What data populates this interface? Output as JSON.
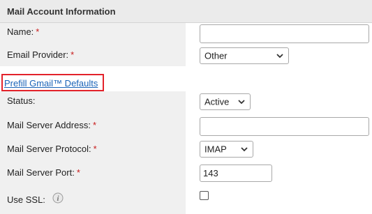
{
  "section": {
    "title": "Mail Account Information",
    "prefill_link": "Prefill Gmail™ Defaults"
  },
  "fields": {
    "name": {
      "label": "Name:",
      "required": "*",
      "value": ""
    },
    "email_provider": {
      "label": "Email Provider:",
      "required": "*",
      "value": "Other"
    },
    "status": {
      "label": "Status:",
      "value": "Active"
    },
    "mail_server_address": {
      "label": "Mail Server Address:",
      "required": "*",
      "value": ""
    },
    "mail_server_protocol": {
      "label": "Mail Server Protocol:",
      "required": "*",
      "value": "IMAP"
    },
    "mail_server_port": {
      "label": "Mail Server Port:",
      "required": "*",
      "value": "143"
    },
    "use_ssl": {
      "label": "Use SSL:",
      "checked": false
    }
  },
  "icons": {
    "info": "info-icon",
    "dropdown": "chevron-down-icon"
  },
  "colors": {
    "required": "#c81a1a",
    "link": "#1a63b8",
    "highlight_border": "#e3222a",
    "label_column": "#f0f0f0",
    "header": "#ebebeb"
  }
}
